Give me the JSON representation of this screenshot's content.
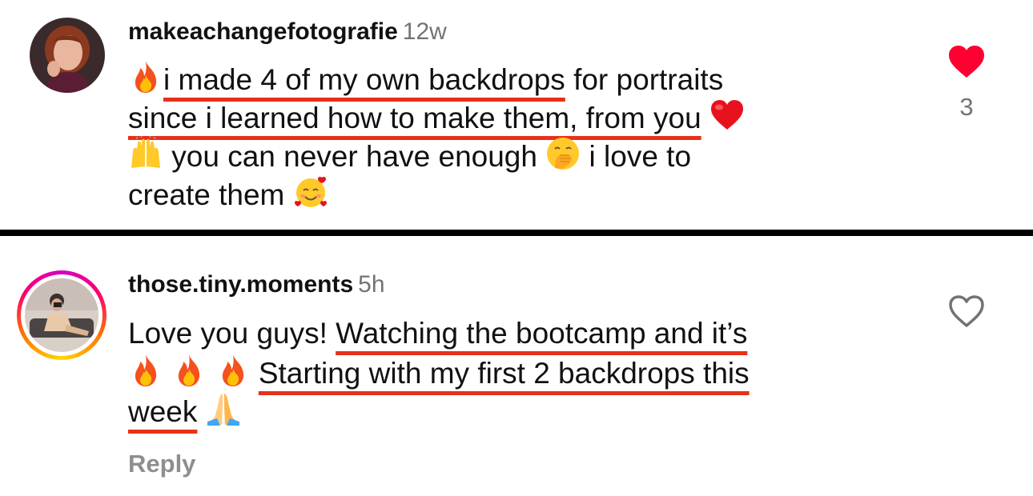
{
  "comments": [
    {
      "username": "makeachangefotografie",
      "time": "12w",
      "likes": "3",
      "liked": true,
      "avatar_icon": "profile-photo-woman-red-hair",
      "lines": [
        {
          "underlined": "i made 4 of my own backdrops",
          "rest": " for portraits"
        },
        {
          "underlined": "since i learned how to make them, from you"
        },
        {
          "text_a": " you can never have enough ",
          "text_b": " i love to"
        },
        {
          "text": "create them "
        }
      ]
    },
    {
      "username": "those.tiny.moments",
      "time": "5h",
      "liked": false,
      "avatar_icon": "profile-photo-with-story-ring",
      "lines": [
        {
          "plain": "Love you guys! ",
          "underlined": "Watching the bootcamp and it’s"
        },
        {
          "underlined": "Starting with my first 2 backdrops this"
        },
        {
          "underlined": "week"
        }
      ],
      "reply_label": "Reply"
    }
  ],
  "colors": {
    "underline": "#e8311a",
    "liked_heart": "#ff0033",
    "muted": "#737373",
    "story_ring": [
      "#d300c5",
      "#ff0069",
      "#ff7a00",
      "#ffd600"
    ]
  },
  "emoji_names": [
    "fire-emoji",
    "red-heart-emoji",
    "raising-hands-emoji",
    "hand-over-mouth-emoji",
    "smiling-face-with-hearts-emoji",
    "folded-hands-emoji"
  ]
}
